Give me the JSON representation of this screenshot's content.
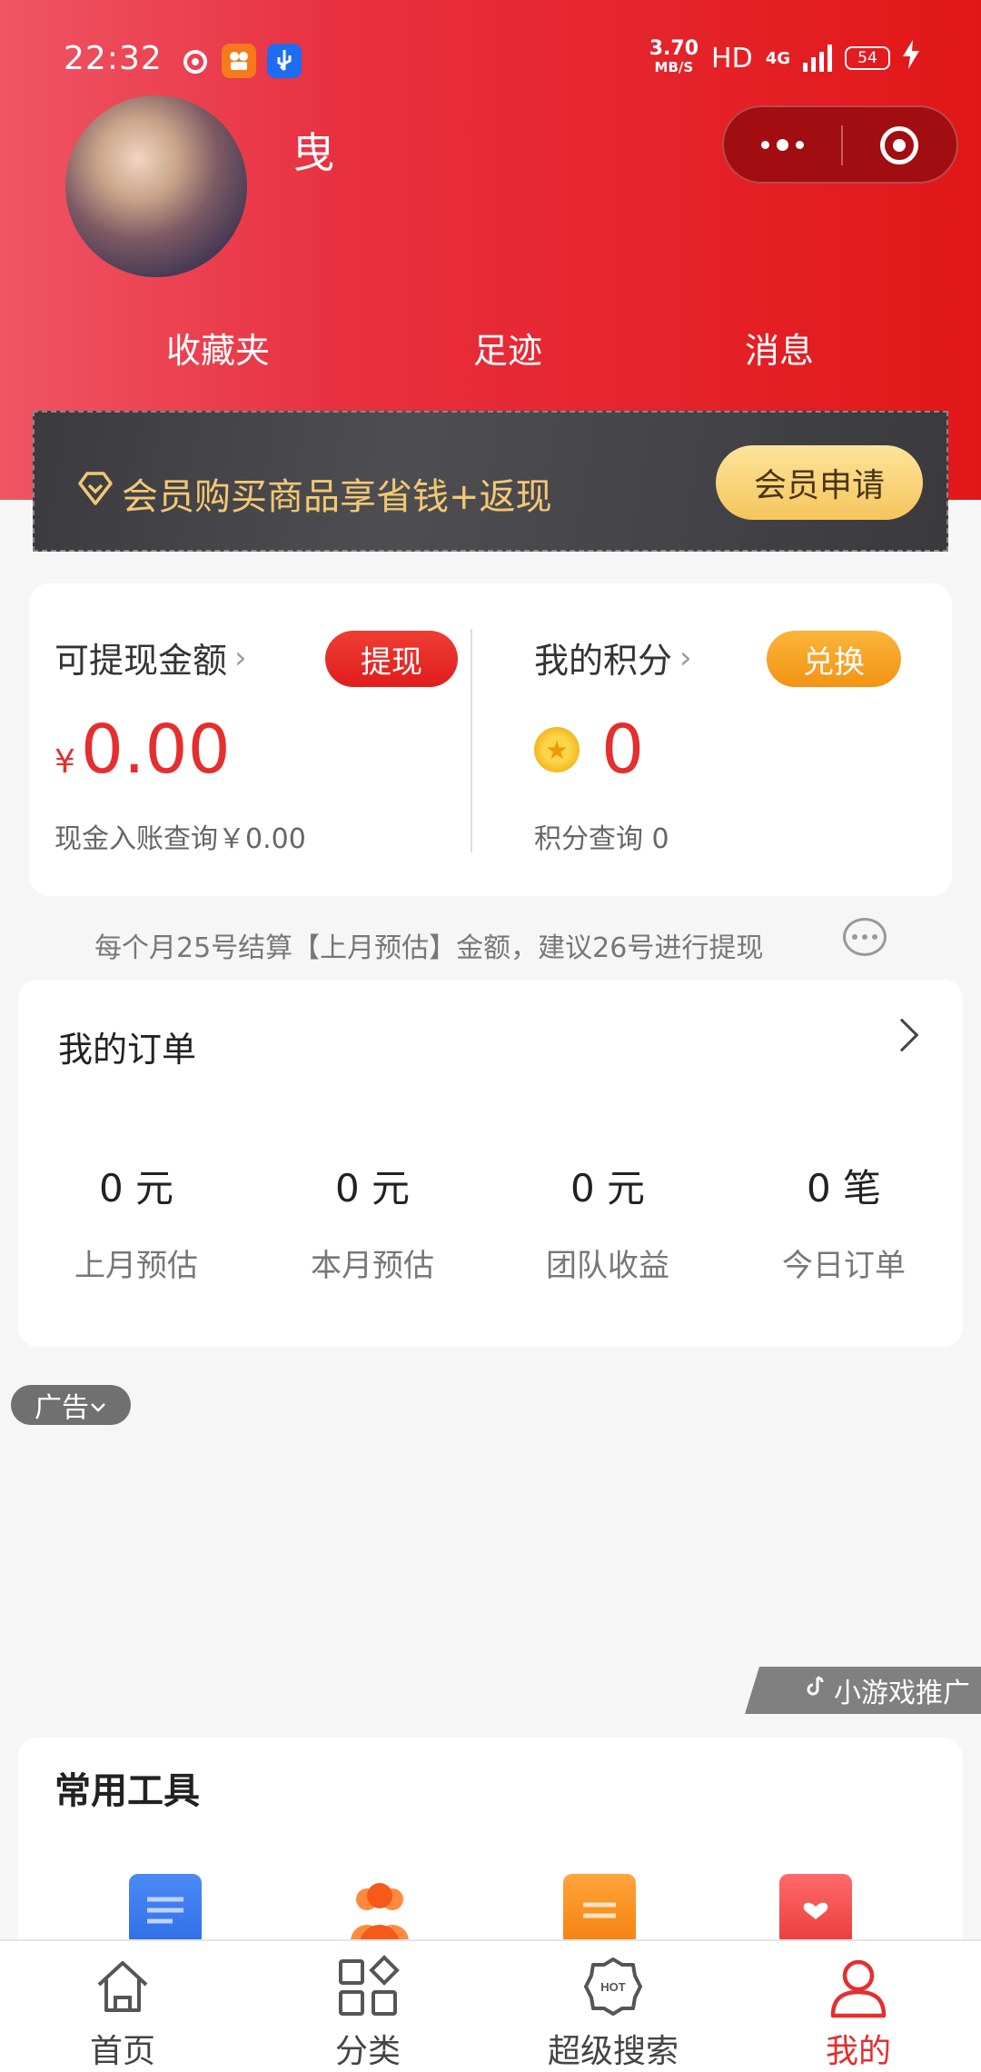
{
  "status_bar": {
    "time": "22:32",
    "speed_value": "3.70",
    "speed_unit": "MB/S",
    "hd": "HD",
    "network": "4G",
    "battery": "54"
  },
  "profile": {
    "username": "曳"
  },
  "quick_links": [
    {
      "label": "收藏夹"
    },
    {
      "label": "足迹"
    },
    {
      "label": "消息"
    }
  ],
  "membership": {
    "banner_text": "会员购买商品享省钱+返现",
    "button_label": "会员申请"
  },
  "balance": {
    "withdraw": {
      "title": "可提现金额",
      "button": "提现",
      "currency": "¥",
      "amount": "0.00",
      "sub": "现金入账查询￥0.00"
    },
    "points": {
      "title": "我的积分",
      "button": "兑换",
      "amount": "0",
      "sub": "积分查询 0"
    }
  },
  "notice": {
    "text": "每个月25号结算【上月预估】金额，建议26号进行提现"
  },
  "orders": {
    "title": "我的订单",
    "stats": [
      {
        "value": "0 元",
        "label": "上月预估"
      },
      {
        "value": "0 元",
        "label": "本月预估"
      },
      {
        "value": "0 元",
        "label": "团队收益"
      },
      {
        "value": "0 笔",
        "label": "今日订单"
      }
    ]
  },
  "ad": {
    "tag": "广告"
  },
  "game_promo": {
    "label": "小游戏推广"
  },
  "tools": {
    "title": "常用工具"
  },
  "tab_bar": {
    "items": [
      {
        "label": "首页"
      },
      {
        "label": "分类"
      },
      {
        "label": "超级搜索"
      },
      {
        "label": "我的"
      }
    ],
    "active_color": "#e52e2e"
  },
  "colors": {
    "header_start": "#ef5565",
    "header_end": "#e11717",
    "accent": "#e52e2e",
    "gold": "#f3c873"
  }
}
